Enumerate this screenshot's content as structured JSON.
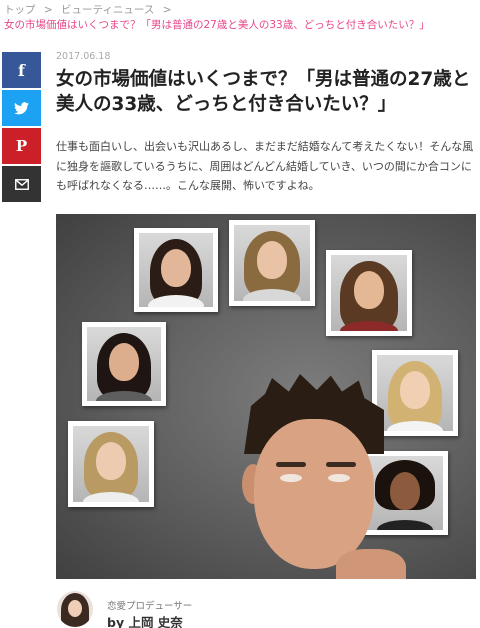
{
  "breadcrumb": {
    "items": [
      "トップ",
      "ビューティニュース"
    ],
    "separator": ">",
    "current": "女の市場価値はいくつまで？「男は普通の27歳と美人の33歳、どっちと付き合いたい？」"
  },
  "share": {
    "facebook": "f",
    "twitter_icon": "twitter-bird-icon",
    "pinterest": "P",
    "mail_icon": "envelope-icon"
  },
  "article": {
    "date": "2017.06.18",
    "title": "女の市場価値はいくつまで？「男は普通の27歳と美人の33歳、どっちと付き合いたい？」",
    "lead": "仕事も面白いし、出会いも沢山あるし、まだまだ結婚なんて考えたくない！そんな風に独身を謳歌しているうちに、周囲はどんどん結婚していき、いつの間にか合コンにも呼ばれなくなる……。こんな展開、怖いですよね。"
  },
  "author": {
    "role": "恋愛プロデューサー",
    "name": "by 上岡 史奈"
  },
  "colors": {
    "breadcrumb_current": "#e8478b",
    "facebook": "#365899",
    "twitter": "#1da1f2",
    "pinterest": "#cb2027",
    "mail": "#333333"
  }
}
